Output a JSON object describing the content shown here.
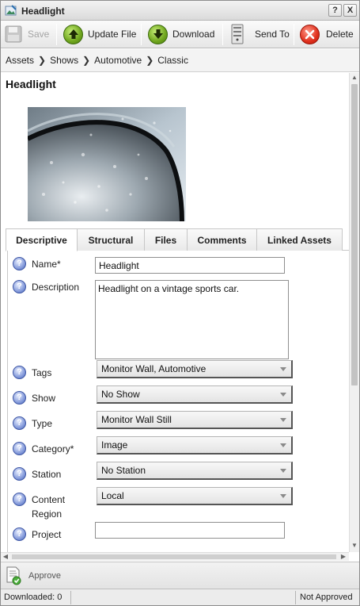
{
  "window": {
    "title": "Headlight",
    "help_label": "?",
    "close_label": "X"
  },
  "toolbar": {
    "save": "Save",
    "update_file": "Update File",
    "download": "Download",
    "send_to": "Send To",
    "delete": "Delete"
  },
  "breadcrumb": [
    "Assets",
    "Shows",
    "Automotive",
    "Classic"
  ],
  "asset": {
    "title": "Headlight"
  },
  "tabs": [
    "Descriptive",
    "Structural",
    "Files",
    "Comments",
    "Linked Assets"
  ],
  "form": {
    "name": {
      "label": "Name*",
      "value": "Headlight"
    },
    "description": {
      "label": "Description",
      "value": "Headlight on a vintage sports car."
    },
    "tags": {
      "label": "Tags",
      "value": "Monitor Wall, Automotive"
    },
    "show": {
      "label": "Show",
      "value": "No Show"
    },
    "type": {
      "label": "Type",
      "value": "Monitor Wall Still"
    },
    "category": {
      "label": "Category*",
      "value": "Image"
    },
    "station": {
      "label": "Station",
      "value": "No Station"
    },
    "content_region": {
      "label": "Content Region",
      "value": "Local"
    },
    "project": {
      "label": "Project",
      "value": ""
    },
    "help_glyph": "?"
  },
  "approve": {
    "label": "Approve"
  },
  "status": {
    "downloaded": "Downloaded: 0",
    "approval": "Not Approved"
  },
  "colors": {
    "accent_green": "#6fa51d",
    "delete_red": "#e0301d",
    "help_blue": "#7e95d8"
  }
}
